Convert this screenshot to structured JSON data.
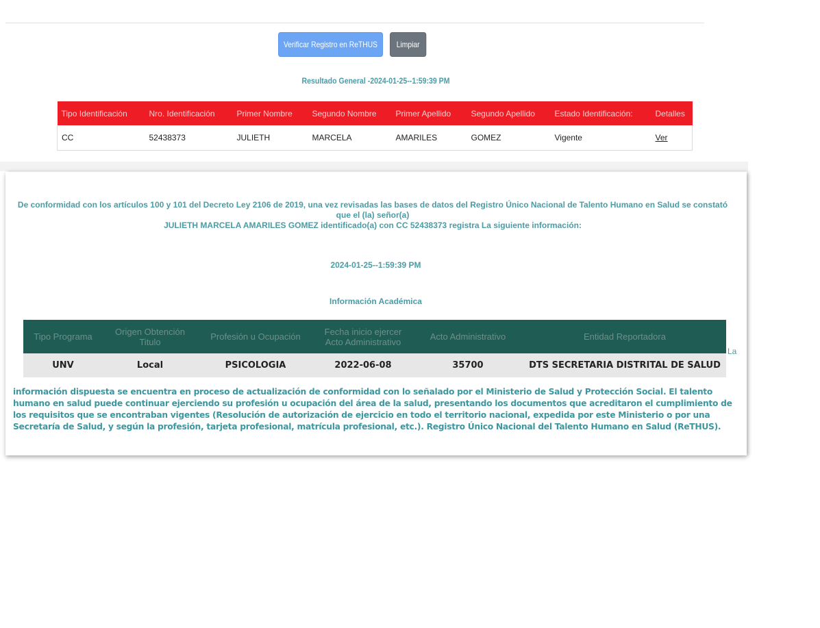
{
  "buttons": {
    "verify_label": "Verificar Registro en ReTHUS",
    "clear_label": "Limpiar"
  },
  "result": {
    "title": "Resultado General -2024-01-25--1:59:39 PM",
    "headers": [
      "Tipo Identificación",
      "Nro. Identificación",
      "Primer Nombre",
      "Segundo Nombre",
      "Primer Apellido",
      "Segundo Apellido",
      "Estado Identificación:",
      "Detalles"
    ],
    "row": [
      "CC",
      "52438373",
      "JULIETH",
      "MARCELA",
      "AMARILES",
      "GOMEZ",
      "Vigente",
      "Ver"
    ]
  },
  "certificate": {
    "intro_line1": "De conformidad con los artículos 100 y 101 del Decreto Ley 2106 de 2019, una vez revisadas las bases de datos del Registro Único Nacional de Talento Humano en Salud se constató que el (la) señor(a)",
    "intro_line2": "JULIETH MARCELA AMARILES GOMEZ identificado(a) con CC 52438373 registra La siguiente información:",
    "datetime": "2024-01-25--1:59:39 PM",
    "academic_title": "Información Académica",
    "academic_headers": [
      "Tipo Programa",
      "Origen Obtención Titulo",
      "Profesión u Ocupación",
      "Fecha inicio ejercer Acto Administrativo",
      "Acto Administrativo",
      "Entidad Reportadora"
    ],
    "academic_row": [
      "UNV",
      "Local",
      "PSICOLOGIA",
      "2022-06-08",
      "35700",
      "DTS SECRETARIA DISTRITAL DE SALUD"
    ],
    "trailing_word": "La",
    "footer_text": "información dispuesta se encuentra en proceso de actualización de conformidad con lo señalado por el Ministerio de Salud y Protección Social. El talento humano en salud puede continuar ejerciendo su profesión u ocupación del área de la salud, presentando los documentos que acreditaron el cumplimiento de los requisitos que se encontraban vigentes (Resolución de autorización de ejercicio en todo el territorio nacional, expedida por este Ministerio o por una Secretaría de Salud, y según la profesión, tarjeta profesional, matrícula profesional, etc.). Registro Único Nacional del Talento Humano en Salud (ReTHUS)."
  },
  "colors": {
    "accent_text": "#4b9ca5",
    "result_header_bg": "#ee1c25",
    "academic_header_bg": "#1f5c54",
    "verify_button_bg": "#6ca5f3",
    "clear_button_bg": "#6c757d"
  }
}
